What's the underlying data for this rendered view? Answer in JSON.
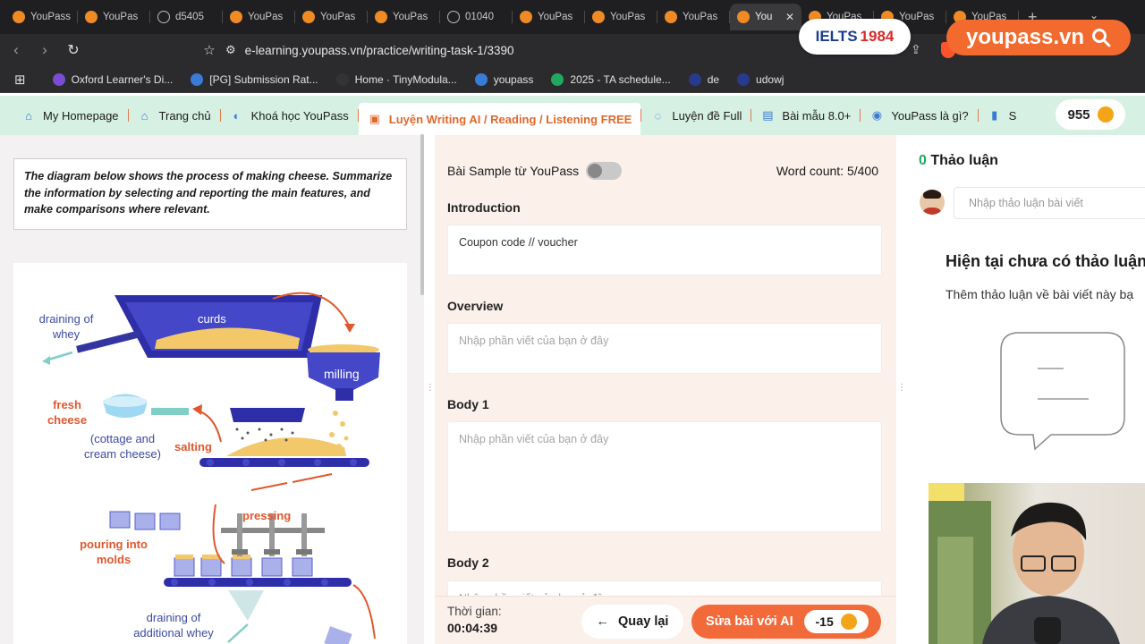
{
  "browser": {
    "tabs": [
      {
        "label": "YouPass",
        "icon": "youpass-icon"
      },
      {
        "label": "YouPas",
        "icon": "youpass-icon"
      },
      {
        "label": "d5405",
        "icon": "globe-icon"
      },
      {
        "label": "YouPas",
        "icon": "youpass-icon"
      },
      {
        "label": "YouPas",
        "icon": "youpass-icon"
      },
      {
        "label": "YouPas",
        "icon": "youpass-icon"
      },
      {
        "label": "01040",
        "icon": "globe-icon"
      },
      {
        "label": "YouPas",
        "icon": "youpass-icon"
      },
      {
        "label": "YouPas",
        "icon": "youpass-icon"
      },
      {
        "label": "YouPas",
        "icon": "youpass-icon"
      },
      {
        "label": "You",
        "icon": "youpass-icon",
        "active": true
      },
      {
        "label": "YouPas",
        "icon": "youpass-icon"
      },
      {
        "label": "YouPas",
        "icon": "youpass-icon"
      },
      {
        "label": "YouPas",
        "icon": "youpass-icon"
      }
    ],
    "url": "e-learning.youpass.vn/practice/writing-task-1/3390",
    "bookmarks": [
      {
        "label": "Oxford Learner's Di...",
        "color": "#7b4bd1"
      },
      {
        "label": "[PG] Submission Rat...",
        "color": "#3a7bd5"
      },
      {
        "label": "Home · TinyModula...",
        "color": "#333333"
      },
      {
        "label": "youpass",
        "color": "#3a7bd5"
      },
      {
        "label": "2025 - TA schedule...",
        "color": "#21a95f"
      },
      {
        "label": "de",
        "color": "#2a3a8a"
      },
      {
        "label": "udowj",
        "color": "#2a3a8a"
      }
    ]
  },
  "overlay": {
    "ielts_brand": "IELTS",
    "ielts_year": "1984",
    "youpass_brand": "youpass.vn"
  },
  "sitenav": {
    "items": [
      {
        "label": "My Homepage",
        "icon": "home-icon"
      },
      {
        "label": "Trang chủ",
        "icon": "home-icon"
      },
      {
        "label": "Khoá học YouPass",
        "icon": "course-icon"
      },
      {
        "label": "Luyện Writing AI / Reading / Listening FREE",
        "icon": "monitor-icon",
        "active": true
      },
      {
        "label": "Luyện đề Full",
        "icon": "swirl-icon"
      },
      {
        "label": "Bài mẫu 8.0+",
        "icon": "document-icon"
      },
      {
        "label": "YouPass là gì?",
        "icon": "person-icon"
      },
      {
        "label": "S",
        "icon": "s-icon"
      }
    ],
    "points": "955"
  },
  "task": {
    "prompt": "The diagram below shows the process of making cheese. Summarize the information by selecting and reporting the main features, and make comparisons where relevant.",
    "diagram_labels": {
      "draining_whey": "draining of whey",
      "curds": "curds",
      "milling": "milling",
      "fresh_cheese": "fresh cheese",
      "cottage": "(cottage and cream cheese)",
      "salting": "salting",
      "pressing": "pressing",
      "pouring": "pouring into molds",
      "draining_additional": "draining of additional whey"
    }
  },
  "editor": {
    "sample_label": "Bài Sample từ YouPass",
    "word_count_label": "Word count: 5/400",
    "sections": [
      {
        "title": "Introduction",
        "value": "Coupon code // voucher",
        "placeholder": ""
      },
      {
        "title": "Overview",
        "value": "",
        "placeholder": "Nhập phần viết của bạn ở đây"
      },
      {
        "title": "Body 1",
        "value": "",
        "placeholder": "Nhập phần viết của bạn ở đây"
      },
      {
        "title": "Body 2",
        "value": "",
        "placeholder": "Nhập phần viết của bạn ở đây"
      }
    ],
    "timer_label": "Thời gian:",
    "timer_value": "00:04:39",
    "back_label": "Quay lại",
    "ai_label": "Sửa bài với AI",
    "ai_cost": "-15"
  },
  "discussion": {
    "count": "0",
    "title": "Thảo luận",
    "input_placeholder": "Nhập thảo luận bài viết",
    "empty_title": "Hiện tại chưa có thảo luận",
    "empty_sub": "Thêm thảo luận về bài viết này bạ"
  },
  "colors": {
    "accent_orange": "#f26a3a",
    "nav_green": "#d7f0e4",
    "count_green": "#21a95f"
  }
}
